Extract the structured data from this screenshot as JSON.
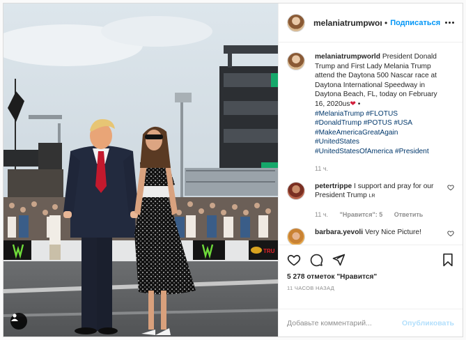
{
  "header": {
    "username": "melaniatrumpworld",
    "separator": "•",
    "follow_label": "Подписаться"
  },
  "caption": {
    "username": "melaniatrumpworld",
    "text_before": "President Donald Trump and First Lady Melania Trump attend the Daytona 500 Nascar race at Daytona International Speedway in Daytona Beach, FL, today on February 16, 2020us",
    "emoji": "❤",
    "text_after": " •",
    "hashtags": [
      "#MelaniaTrump",
      "#FLOTUS",
      "#DonaldTrump",
      "#POTUS",
      "#USA",
      "#MakeAmericaGreatAgain",
      "#UnitedStates",
      "#UnitedStatesOfAmerica",
      "#President"
    ],
    "time": "11 ч."
  },
  "comments": [
    {
      "username": "petertrippe",
      "text": "I support and pray for our President Trump",
      "suffix": "LR",
      "time": "11 ч.",
      "likes": "\"Нравится\": 5",
      "reply": "Ответить"
    },
    {
      "username": "barbara.yevoli",
      "text": "Very Nice Picture!"
    }
  ],
  "actions": {
    "likes_count": "5 278 отметок \"Нравится\"",
    "time_ago": "11 часов назад"
  },
  "add_comment": {
    "placeholder": "Добавьте комментарий...",
    "publish_label": "Опубликовать"
  },
  "photo": {
    "banner_texts": [
      "TRU"
    ]
  }
}
